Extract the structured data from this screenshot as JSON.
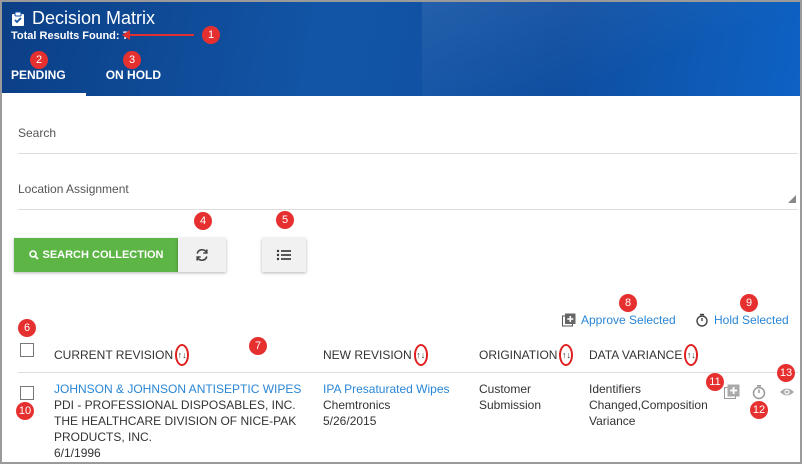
{
  "app": {
    "title": "Decision Matrix",
    "results_label": "Total Results Found: 7"
  },
  "tabs": [
    {
      "label": "PENDING",
      "active": true
    },
    {
      "label": "ON HOLD",
      "active": false
    }
  ],
  "filters": {
    "search_placeholder": "Search",
    "location_placeholder": "Location Assignment"
  },
  "toolbar": {
    "search_label": "SEARCH COLLECTION"
  },
  "actions": {
    "approve_label": "Approve Selected",
    "hold_label": "Hold Selected"
  },
  "columns": [
    {
      "label": "CURRENT REVISION"
    },
    {
      "label": "NEW REVISION"
    },
    {
      "label": "ORIGINATION"
    },
    {
      "label": "DATA VARIANCE"
    }
  ],
  "rows": [
    {
      "current": {
        "name": "JOHNSON & JOHNSON ANTISEPTIC WIPES",
        "company": "PDI - PROFESSIONAL DISPOSABLES, INC. THE HEALTHCARE DIVISION OF NICE-PAK PRODUCTS, INC.",
        "date": "6/1/1996"
      },
      "new": {
        "name": "IPA Presaturated Wipes",
        "company": "Chemtronics",
        "date": "5/26/2015"
      },
      "origination": "Customer Submission",
      "variance": "Identifiers Changed,Composition Variance"
    }
  ],
  "callouts": [
    "1",
    "2",
    "3",
    "4",
    "5",
    "6",
    "7",
    "8",
    "9",
    "10",
    "11",
    "12",
    "13"
  ],
  "colors": {
    "header": "#1255a6",
    "accent_green": "#5cb545",
    "link": "#2a86d6",
    "callout": "#e63030"
  }
}
